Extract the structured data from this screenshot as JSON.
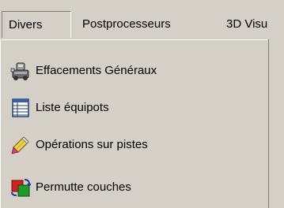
{
  "menubar": {
    "items": [
      {
        "label": "Divers"
      },
      {
        "label": "Postprocesseurs"
      },
      {
        "label": "3D Visu"
      }
    ]
  },
  "dropdown": {
    "items": [
      {
        "label": "Effacements Généraux",
        "icon": "eraser-machine-icon"
      },
      {
        "label": "Liste équipots",
        "icon": "list-table-icon"
      },
      {
        "label": "Opérations sur  pistes",
        "icon": "pencil-icon"
      },
      {
        "label": "Permutte couches",
        "icon": "swap-layers-icon"
      }
    ]
  }
}
